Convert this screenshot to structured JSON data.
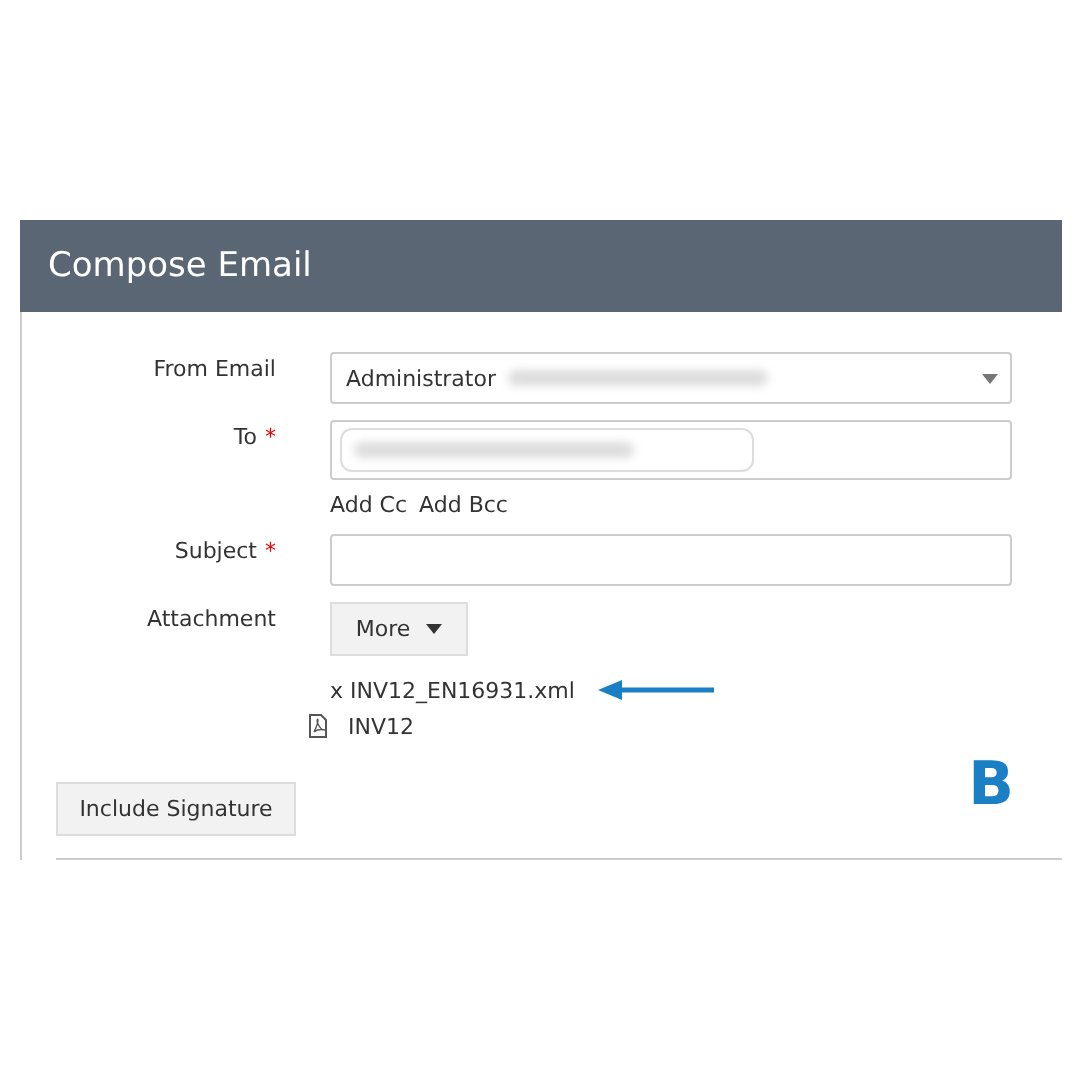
{
  "window": {
    "title": "Compose Email"
  },
  "fields": [
    {
      "label": "From Email",
      "kind": "select",
      "value": "Administrator"
    },
    {
      "label": "To",
      "required_mark": "*",
      "kind": "chips"
    },
    {
      "label": "Subject",
      "required_mark": "*",
      "kind": "text"
    }
  ],
  "cc_links": [
    "Add Cc",
    "Add Bcc"
  ],
  "attachment": {
    "label": "Attachment",
    "button": "More",
    "files": [
      {
        "name": "x INV12_EN16931.xml",
        "kind": "plain",
        "arrow": true
      },
      {
        "name": "INV12",
        "kind": "pdf",
        "arrow": false
      }
    ]
  },
  "signature_button": "Include Signature",
  "marker": "B"
}
